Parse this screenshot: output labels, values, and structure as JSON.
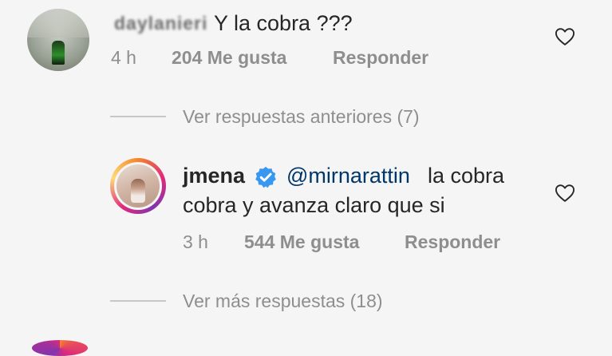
{
  "comments": [
    {
      "username": "daylanieri",
      "text": "Y la cobra ???",
      "time": "4 h",
      "likes": "204 Me gusta",
      "reply_label": "Responder",
      "icon": "heart-outline-icon"
    }
  ],
  "view_previous": "Ver respuestas anteriores (7)",
  "reply": {
    "username": "jmena",
    "verified_icon": "verified-badge-icon",
    "mention": "@mirnarattin",
    "text_line1": "la cobra",
    "text_line2": "cobra y avanza claro que si",
    "time": "3 h",
    "likes": "544 Me gusta",
    "reply_label": "Responder",
    "icon": "heart-outline-icon"
  },
  "view_more": "Ver más respuestas (18)",
  "colors": {
    "background": "#f5f5f5",
    "text": "#262626",
    "secondary": "#8e8e8e",
    "link": "#00376b",
    "verified": "#3897f0"
  }
}
